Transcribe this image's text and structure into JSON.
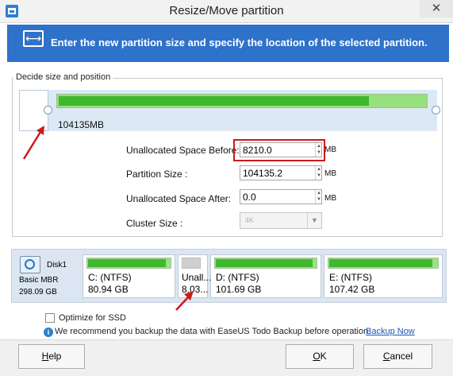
{
  "window": {
    "title": "Resize/Move partition",
    "close_glyph": "✕"
  },
  "banner": {
    "text": "Enter the new partition size and specify the location of the selected partition.",
    "icon": "resize-arrows-icon"
  },
  "group": {
    "label": "Decide size and position",
    "partition_size_text": "104135MB",
    "fill_fraction": 0.84
  },
  "fields": {
    "before": {
      "label": "Unallocated Space Before:",
      "value": "8210.0",
      "unit": "MB"
    },
    "size": {
      "label": "Partition Size :",
      "value": "104135.2",
      "unit": "MB"
    },
    "after": {
      "label": "Unallocated Space After:",
      "value": "0.0",
      "unit": "MB"
    },
    "cluster": {
      "label": "Cluster Size :",
      "value": "4K"
    }
  },
  "disk": {
    "name": "Disk1",
    "type": "Basic MBR",
    "size": "298.09 GB",
    "partitions": [
      {
        "name": "C: (NTFS)",
        "size": "80.94 GB",
        "used_fraction": 0.95
      },
      {
        "name": "Unall...",
        "size": "8.03...",
        "used_fraction": 0
      },
      {
        "name": "D: (NTFS)",
        "size": "101.69 GB",
        "used_fraction": 0.97
      },
      {
        "name": "E: (NTFS)",
        "size": "107.42 GB",
        "used_fraction": 0.96
      }
    ]
  },
  "options": {
    "ssd_label": "Optimize for SSD",
    "ssd_checked": false,
    "info_text": "We recommend you backup the data with EaseUS Todo Backup before operation.",
    "backup_link": "Backup Now"
  },
  "buttons": {
    "help": "Help",
    "ok": "OK",
    "cancel": "Cancel"
  },
  "colors": {
    "banner": "#2f72c9",
    "used": "#3fb830",
    "highlight": "#cc1a1a"
  }
}
